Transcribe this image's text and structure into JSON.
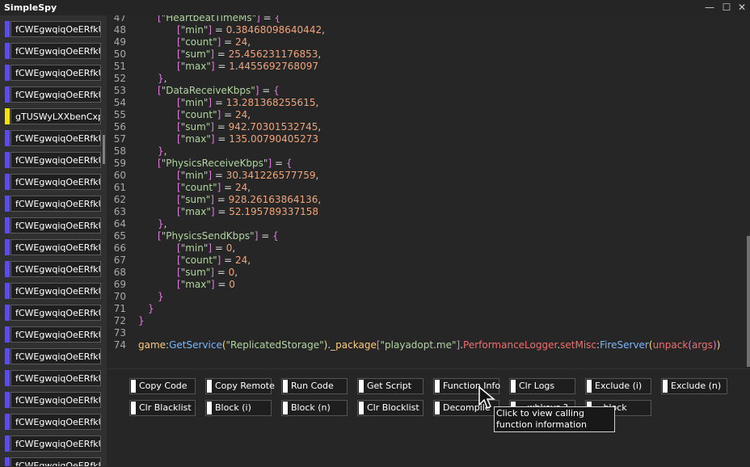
{
  "window": {
    "title": "SimpleSpy",
    "minimize": "—",
    "maximize": "☐",
    "close": "✕"
  },
  "remotes": [
    {
      "name": "fCWEgwqiqOeERfkUih",
      "color": "#5a4de8"
    },
    {
      "name": "fCWEgwqiqOeERfkUih",
      "color": "#5a4de8"
    },
    {
      "name": "fCWEgwqiqOeERfkUih",
      "color": "#5a4de8"
    },
    {
      "name": "fCWEgwqiqOeERfkUih",
      "color": "#5a4de8"
    },
    {
      "name": "gTUSWyLXXbenCxpIVd",
      "color": "#f3e018"
    },
    {
      "name": "fCWEgwqiqOeERfkUih",
      "color": "#5a4de8"
    },
    {
      "name": "fCWEgwqiqOeERfkUih",
      "color": "#5a4de8"
    },
    {
      "name": "fCWEgwqiqOeERfkUih",
      "color": "#5a4de8"
    },
    {
      "name": "fCWEgwqiqOeERfkUih",
      "color": "#5a4de8"
    },
    {
      "name": "fCWEgwqiqOeERfkUih",
      "color": "#5a4de8"
    },
    {
      "name": "fCWEgwqiqOeERfkUih",
      "color": "#5a4de8"
    },
    {
      "name": "fCWEgwqiqOeERfkUih",
      "color": "#5a4de8"
    },
    {
      "name": "fCWEgwqiqOeERfkUih",
      "color": "#5a4de8"
    },
    {
      "name": "fCWEgwqiqOeERfkUih",
      "color": "#5a4de8"
    },
    {
      "name": "fCWEgwqiqOeERfkUih",
      "color": "#5a4de8"
    },
    {
      "name": "fCWEgwqiqOeERfkUih",
      "color": "#5a4de8"
    },
    {
      "name": "fCWEgwqiqOeERfkUih",
      "color": "#5a4de8"
    },
    {
      "name": "fCWEgwqiqOeERfkUih",
      "color": "#5a4de8"
    },
    {
      "name": "fCWEgwqiqOeERfkUih",
      "color": "#5a4de8"
    },
    {
      "name": "fCWEgwqiqOeERfkUih",
      "color": "#5a4de8"
    },
    {
      "name": "fCWEgwqiqOeERfkUih",
      "color": "#5a4de8"
    }
  ],
  "code": {
    "lines": [
      {
        "n": "47",
        "indent": 1,
        "text": "[\"HeartbeatTimeMs\"] = {"
      },
      {
        "n": "48",
        "indent": 2,
        "text": "[\"min\"] = 0.38468098640442,"
      },
      {
        "n": "49",
        "indent": 2,
        "text": "[\"count\"] = 24,"
      },
      {
        "n": "50",
        "indent": 2,
        "text": "[\"sum\"] = 25.456231176853,"
      },
      {
        "n": "51",
        "indent": 2,
        "text": "[\"max\"] = 1.4455692768097"
      },
      {
        "n": "52",
        "indent": 1,
        "text": "},"
      },
      {
        "n": "53",
        "indent": 1,
        "text": "[\"DataReceiveKbps\"] = {"
      },
      {
        "n": "54",
        "indent": 2,
        "text": "[\"min\"] = 13.281368255615,"
      },
      {
        "n": "55",
        "indent": 2,
        "text": "[\"count\"] = 24,"
      },
      {
        "n": "56",
        "indent": 2,
        "text": "[\"sum\"] = 942.70301532745,"
      },
      {
        "n": "57",
        "indent": 2,
        "text": "[\"max\"] = 135.00790405273"
      },
      {
        "n": "58",
        "indent": 1,
        "text": "},"
      },
      {
        "n": "59",
        "indent": 1,
        "text": "[\"PhysicsReceiveKbps\"] = {"
      },
      {
        "n": "60",
        "indent": 2,
        "text": "[\"min\"] = 30.341226577759,"
      },
      {
        "n": "61",
        "indent": 2,
        "text": "[\"count\"] = 24,"
      },
      {
        "n": "62",
        "indent": 2,
        "text": "[\"sum\"] = 928.26163864136,"
      },
      {
        "n": "63",
        "indent": 2,
        "text": "[\"max\"] = 52.195789337158"
      },
      {
        "n": "64",
        "indent": 1,
        "text": "},"
      },
      {
        "n": "65",
        "indent": 1,
        "text": "[\"PhysicsSendKbps\"] = {"
      },
      {
        "n": "66",
        "indent": 2,
        "text": "[\"min\"] = 0,"
      },
      {
        "n": "67",
        "indent": 2,
        "text": "[\"count\"] = 24,"
      },
      {
        "n": "68",
        "indent": 2,
        "text": "[\"sum\"] = 0,"
      },
      {
        "n": "69",
        "indent": 2,
        "text": "[\"max\"] = 0"
      },
      {
        "n": "70",
        "indent": 1,
        "text": "}"
      },
      {
        "n": "71",
        "indent": 0.5,
        "text": "}"
      },
      {
        "n": "72",
        "indent": 0,
        "text": "}"
      },
      {
        "n": "73",
        "indent": 0,
        "text": ""
      },
      {
        "n": "74",
        "indent": 0,
        "text": "game:GetService(\"ReplicatedStorage\")._package[\"playadopt.me\"].PerformanceLogger.setMisc:FireServer(unpack(args))"
      }
    ]
  },
  "buttons": [
    {
      "label": "Copy Code"
    },
    {
      "label": "Copy Remote"
    },
    {
      "label": "Run Code"
    },
    {
      "label": "Get Script"
    },
    {
      "label": "Function Info"
    },
    {
      "label": "Clr Logs"
    },
    {
      "label": "Exclude (i)"
    },
    {
      "label": "Exclude (n)"
    },
    {
      "label": "Clr Blacklist"
    },
    {
      "label": "Block (i)"
    },
    {
      "label": "Block (n)"
    },
    {
      "label": "Clr Blocklist"
    },
    {
      "label": "Decompile"
    },
    {
      "label": "...wbkeys ?"
    },
    {
      "label": "...block"
    }
  ],
  "tooltip": {
    "text": "Click to view calling function information"
  }
}
